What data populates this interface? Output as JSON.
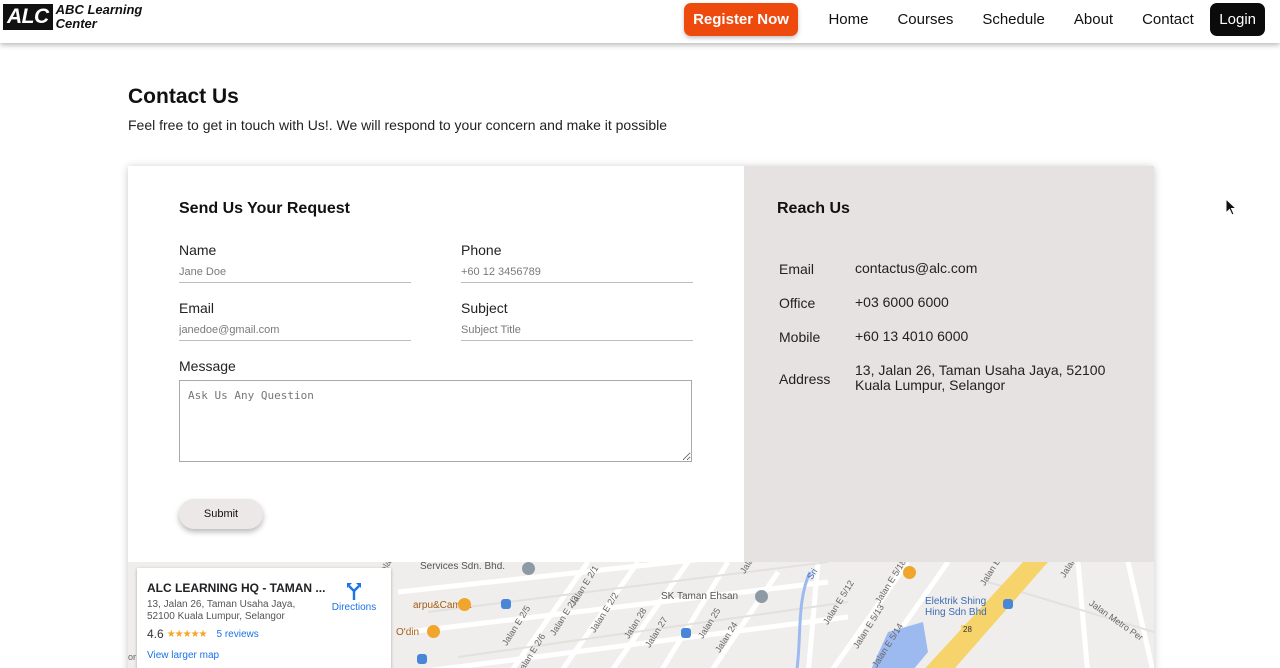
{
  "header": {
    "logo_mark": "ALC",
    "logo_line1": "ABC Learning",
    "logo_line2": "Center",
    "register_label": "Register Now",
    "nav": [
      "Home",
      "Courses",
      "Schedule",
      "About",
      "Contact"
    ],
    "login_label": "Login"
  },
  "page": {
    "title": "Contact Us",
    "subtitle": "Feel free to get in touch with Us!. We will respond to your concern and make it possible"
  },
  "form": {
    "title": "Send Us Your Request",
    "name_label": "Name",
    "name_placeholder": "Jane Doe",
    "phone_label": "Phone",
    "phone_placeholder": "+60 12 3456789",
    "email_label": "Email",
    "email_placeholder": "janedoe@gmail.com",
    "subject_label": "Subject",
    "subject_placeholder": "Subject Title",
    "message_label": "Message",
    "message_placeholder": "Ask Us Any Question",
    "submit_label": "Submit"
  },
  "reach": {
    "title": "Reach Us",
    "email_label": "Email",
    "email_value": "contactus@alc.com",
    "office_label": "Office",
    "office_value": "+03 6000 6000",
    "mobile_label": "Mobile",
    "mobile_value": "+60 13 4010 6000",
    "address_label": "Address",
    "address_value": "13, Jalan 26, Taman Usaha Jaya, 52100 Kuala Lumpur, Selangor"
  },
  "map": {
    "place_name": "ALC LEARNING HQ - TAMAN ...",
    "place_address": "13, Jalan 26, Taman Usaha Jaya, 52100 Kuala Lumpur, Selangor",
    "rating": "4.6",
    "stars": "★★★★★",
    "reviews": "5 reviews",
    "larger_map": "View larger map",
    "directions": "Directions",
    "attribution": "or",
    "labels": {
      "services": "Services Sdn. Bhd.",
      "carpu": "arpu&Camca",
      "odin": "O'din",
      "sk_taman": "SK Taman Ehsan",
      "elektrik": "Elektrik Shing",
      "elektrik2": "Hing Sdn Bhd",
      "route": "28",
      "j_e21": "Jalan E 2/1",
      "j_e22": "Jalan E 2/2",
      "j_e23": "Jalan E 2/3",
      "j_e25": "Jalan E 2/5",
      "j_e26": "Jalan E 2/6",
      "j_28": "Jalan 28",
      "j_27": "Jalan 27",
      "j_25": "Jalan 25",
      "j_24": "Jalan 24",
      "j_e512": "Jalan E 5/12",
      "j_e513": "Jalan E 5/13",
      "j_e514": "Jalan E 5/14",
      "j_e518": "Jalan E 5/18",
      "j_e516": "Jalan E 5/16",
      "j_metro": "Jalan Metro Per",
      "j_e": "Jalan E",
      "j_e35": "Jalan E 3/5",
      "j_53": "Jalan 5/3",
      "sri": "Sri"
    }
  },
  "colors": {
    "accent": "#ee4a0e",
    "reach_bg": "#e6e2e1",
    "login_bg": "#0b0b0b",
    "link": "#1a73e8"
  }
}
